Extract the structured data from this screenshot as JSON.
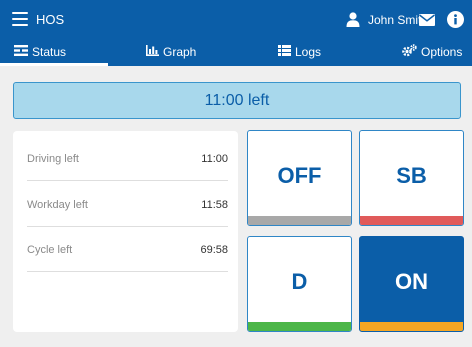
{
  "header": {
    "title": "HOS",
    "user_name": "John Smith",
    "icons": [
      "menu-icon",
      "user-icon",
      "mail-icon",
      "info-icon"
    ]
  },
  "tabs": [
    {
      "label": "Status",
      "icon": "status-icon",
      "active": true
    },
    {
      "label": "Graph",
      "icon": "bar-chart-icon",
      "active": false
    },
    {
      "label": "Logs",
      "icon": "list-icon",
      "active": false
    },
    {
      "label": "Options",
      "icon": "gears-icon",
      "active": false
    }
  ],
  "banner": {
    "text": "11:00 left"
  },
  "stats": [
    {
      "label": "Driving left",
      "value": "11:00"
    },
    {
      "label": "Workday left",
      "value": "11:58"
    },
    {
      "label": "Cycle left",
      "value": "69:58"
    }
  ],
  "statuses": [
    {
      "code": "OFF",
      "strip_color": "#a8a8a8",
      "active": false
    },
    {
      "code": "SB",
      "strip_color": "#e05a5a",
      "active": false
    },
    {
      "code": "D",
      "strip_color": "#4cb648",
      "active": false
    },
    {
      "code": "ON",
      "strip_color": "#f5a623",
      "active": true
    }
  ],
  "colors": {
    "primary": "#0b5ea8",
    "banner_bg": "#a8d8ec",
    "background": "#efefef"
  }
}
